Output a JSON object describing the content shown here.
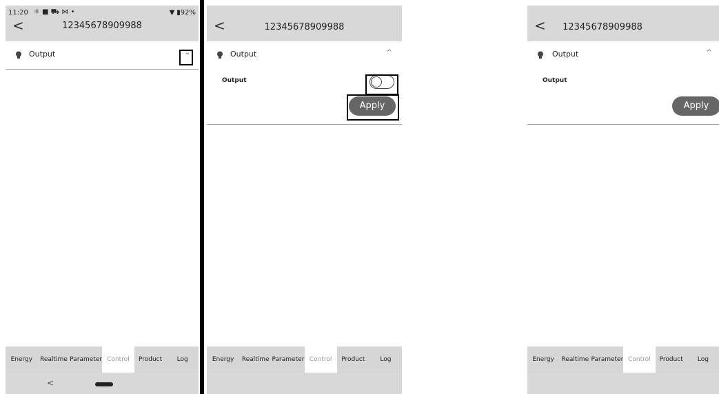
{
  "status_bar": {
    "time": "11:20",
    "notification_glyphs": "⚛ ■ ⛟ ⋈ •",
    "wifi": "▼",
    "battery": "▮92%"
  },
  "device": {
    "title": "12345678909988",
    "back_glyph": "<"
  },
  "section": {
    "label": "Output",
    "expanded_glyph": "^",
    "collapsed_glyph": "⌄"
  },
  "output_control": {
    "label": "Output",
    "toggle_on": false,
    "apply_label": "Apply"
  },
  "tabs": [
    {
      "label": "Energy",
      "active": false
    },
    {
      "label": "Realtime",
      "active": false
    },
    {
      "label": "Parameter",
      "active": false
    },
    {
      "label": "Control",
      "active": true
    },
    {
      "label": "Product",
      "active": false
    },
    {
      "label": "Log",
      "active": false
    }
  ],
  "nav_bar": {
    "back_glyph": "<"
  },
  "colors": {
    "header_bg": "#d8d8d8",
    "apply_bg": "#666666",
    "highlight": "#000000"
  }
}
